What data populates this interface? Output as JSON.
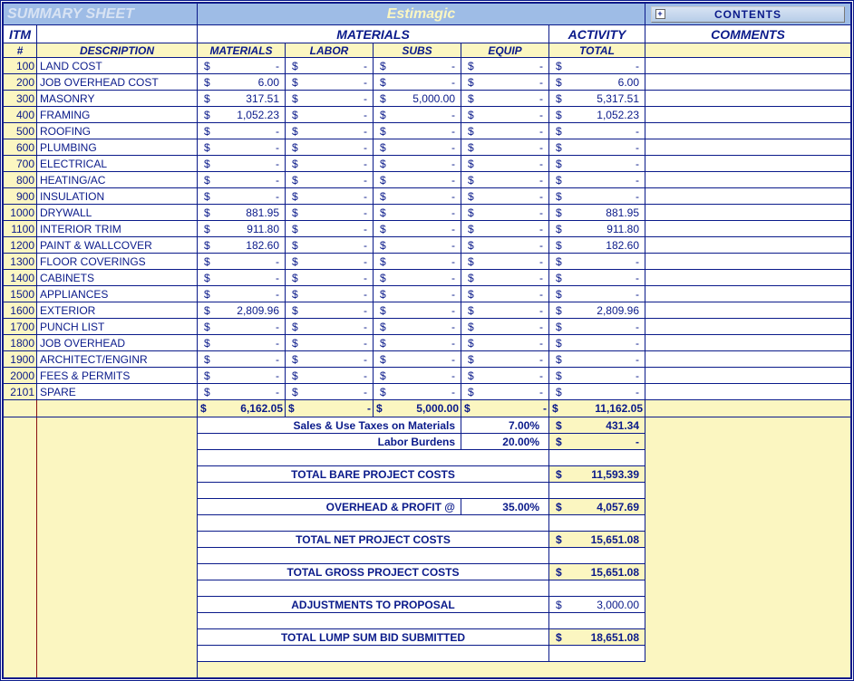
{
  "header": {
    "title_left": "SUMMARY SHEET",
    "title_center": "Estimagic",
    "contents_btn": "CONTENTS"
  },
  "header2": {
    "itm": "ITM",
    "materials": "MATERIALS",
    "activity": "ACTIVITY",
    "comments": "COMMENTS"
  },
  "header3": {
    "num": "#",
    "description": "DESCRIPTION",
    "materials": "MATERIALS",
    "labor": "LABOR",
    "subs": "SUBS",
    "equip": "EQUIP",
    "total": "TOTAL"
  },
  "rows": [
    {
      "itm": "100",
      "desc": "LAND COST",
      "mat": "-",
      "lab": "-",
      "subs": "-",
      "equip": "-",
      "total": "-"
    },
    {
      "itm": "200",
      "desc": "JOB OVERHEAD COST",
      "mat": "6.00",
      "lab": "-",
      "subs": "-",
      "equip": "-",
      "total": "6.00"
    },
    {
      "itm": "300",
      "desc": "MASONRY",
      "mat": "317.51",
      "lab": "-",
      "subs": "5,000.00",
      "equip": "-",
      "total": "5,317.51"
    },
    {
      "itm": "400",
      "desc": "FRAMING",
      "mat": "1,052.23",
      "lab": "-",
      "subs": "-",
      "equip": "-",
      "total": "1,052.23"
    },
    {
      "itm": "500",
      "desc": "ROOFING",
      "mat": "-",
      "lab": "-",
      "subs": "-",
      "equip": "-",
      "total": "-"
    },
    {
      "itm": "600",
      "desc": "PLUMBING",
      "mat": "-",
      "lab": "-",
      "subs": "-",
      "equip": "-",
      "total": "-"
    },
    {
      "itm": "700",
      "desc": "ELECTRICAL",
      "mat": "-",
      "lab": "-",
      "subs": "-",
      "equip": "-",
      "total": "-"
    },
    {
      "itm": "800",
      "desc": "HEATING/AC",
      "mat": "-",
      "lab": "-",
      "subs": "-",
      "equip": "-",
      "total": "-"
    },
    {
      "itm": "900",
      "desc": "INSULATION",
      "mat": "-",
      "lab": "-",
      "subs": "-",
      "equip": "-",
      "total": "-"
    },
    {
      "itm": "1000",
      "desc": "DRYWALL",
      "mat": "881.95",
      "lab": "-",
      "subs": "-",
      "equip": "-",
      "total": "881.95"
    },
    {
      "itm": "1100",
      "desc": "INTERIOR TRIM",
      "mat": "911.80",
      "lab": "-",
      "subs": "-",
      "equip": "-",
      "total": "911.80"
    },
    {
      "itm": "1200",
      "desc": "PAINT & WALLCOVER",
      "mat": "182.60",
      "lab": "-",
      "subs": "-",
      "equip": "-",
      "total": "182.60"
    },
    {
      "itm": "1300",
      "desc": "FLOOR COVERINGS",
      "mat": "-",
      "lab": "-",
      "subs": "-",
      "equip": "-",
      "total": "-"
    },
    {
      "itm": "1400",
      "desc": "CABINETS",
      "mat": "-",
      "lab": "-",
      "subs": "-",
      "equip": "-",
      "total": "-"
    },
    {
      "itm": "1500",
      "desc": "APPLIANCES",
      "mat": "-",
      "lab": "-",
      "subs": "-",
      "equip": "-",
      "total": "-"
    },
    {
      "itm": "1600",
      "desc": "EXTERIOR",
      "mat": "2,809.96",
      "lab": "-",
      "subs": "-",
      "equip": "-",
      "total": "2,809.96"
    },
    {
      "itm": "1700",
      "desc": "PUNCH LIST",
      "mat": "-",
      "lab": "-",
      "subs": "-",
      "equip": "-",
      "total": "-"
    },
    {
      "itm": "1800",
      "desc": "JOB OVERHEAD",
      "mat": "-",
      "lab": "-",
      "subs": "-",
      "equip": "-",
      "total": "-"
    },
    {
      "itm": "1900",
      "desc": "ARCHITECT/ENGINR",
      "mat": "-",
      "lab": "-",
      "subs": "-",
      "equip": "-",
      "total": "-"
    },
    {
      "itm": "2000",
      "desc": "FEES & PERMITS",
      "mat": "-",
      "lab": "-",
      "subs": "-",
      "equip": "-",
      "total": "-"
    },
    {
      "itm": "2101",
      "desc": "SPARE",
      "mat": "-",
      "lab": "-",
      "subs": "-",
      "equip": "-",
      "total": "-"
    }
  ],
  "subtotals": {
    "mat": "6,162.05",
    "lab": "-",
    "subs": "5,000.00",
    "equip": "-",
    "total": "11,162.05"
  },
  "footer": {
    "sales_tax_label": "Sales & Use Taxes on Materials",
    "sales_tax_pct": "7.00%",
    "sales_tax_val": "431.34",
    "labor_burdens_label": "Labor Burdens",
    "labor_burdens_pct": "20.00%",
    "labor_burdens_val": "-",
    "total_bare_label": "TOTAL BARE PROJECT COSTS",
    "total_bare_val": "11,593.39",
    "overhead_label": "OVERHEAD & PROFIT @",
    "overhead_pct": "35.00%",
    "overhead_val": "4,057.69",
    "total_net_label": "TOTAL NET PROJECT COSTS",
    "total_net_val": "15,651.08",
    "total_gross_label": "TOTAL GROSS PROJECT COSTS",
    "total_gross_val": "15,651.08",
    "adjustments_label": "ADJUSTMENTS TO PROPOSAL",
    "adjustments_val": "3,000.00",
    "total_lump_label": "TOTAL LUMP SUM BID SUBMITTED",
    "total_lump_val": "18,651.08"
  },
  "chart_data": {
    "type": "table",
    "title": "Summary Sheet — Estimagic",
    "columns": [
      "ITM",
      "DESCRIPTION",
      "MATERIALS",
      "LABOR",
      "SUBS",
      "EQUIP",
      "TOTAL"
    ],
    "rows": [
      [
        100,
        "LAND COST",
        0,
        0,
        0,
        0,
        0
      ],
      [
        200,
        "JOB OVERHEAD COST",
        6.0,
        0,
        0,
        0,
        6.0
      ],
      [
        300,
        "MASONRY",
        317.51,
        0,
        5000.0,
        0,
        5317.51
      ],
      [
        400,
        "FRAMING",
        1052.23,
        0,
        0,
        0,
        1052.23
      ],
      [
        500,
        "ROOFING",
        0,
        0,
        0,
        0,
        0
      ],
      [
        600,
        "PLUMBING",
        0,
        0,
        0,
        0,
        0
      ],
      [
        700,
        "ELECTRICAL",
        0,
        0,
        0,
        0,
        0
      ],
      [
        800,
        "HEATING/AC",
        0,
        0,
        0,
        0,
        0
      ],
      [
        900,
        "INSULATION",
        0,
        0,
        0,
        0,
        0
      ],
      [
        1000,
        "DRYWALL",
        881.95,
        0,
        0,
        0,
        881.95
      ],
      [
        1100,
        "INTERIOR TRIM",
        911.8,
        0,
        0,
        0,
        911.8
      ],
      [
        1200,
        "PAINT & WALLCOVER",
        182.6,
        0,
        0,
        0,
        182.6
      ],
      [
        1300,
        "FLOOR COVERINGS",
        0,
        0,
        0,
        0,
        0
      ],
      [
        1400,
        "CABINETS",
        0,
        0,
        0,
        0,
        0
      ],
      [
        1500,
        "APPLIANCES",
        0,
        0,
        0,
        0,
        0
      ],
      [
        1600,
        "EXTERIOR",
        2809.96,
        0,
        0,
        0,
        2809.96
      ],
      [
        1700,
        "PUNCH LIST",
        0,
        0,
        0,
        0,
        0
      ],
      [
        1800,
        "JOB OVERHEAD",
        0,
        0,
        0,
        0,
        0
      ],
      [
        1900,
        "ARCHITECT/ENGINR",
        0,
        0,
        0,
        0,
        0
      ],
      [
        2000,
        "FEES & PERMITS",
        0,
        0,
        0,
        0,
        0
      ],
      [
        2101,
        "SPARE",
        0,
        0,
        0,
        0,
        0
      ]
    ],
    "subtotals": {
      "MATERIALS": 6162.05,
      "LABOR": 0,
      "SUBS": 5000.0,
      "EQUIP": 0,
      "TOTAL": 11162.05
    },
    "summary": {
      "sales_use_tax_pct": 7.0,
      "sales_use_tax": 431.34,
      "labor_burdens_pct": 20.0,
      "labor_burdens": 0,
      "total_bare_project_costs": 11593.39,
      "overhead_profit_pct": 35.0,
      "overhead_profit": 4057.69,
      "total_net_project_costs": 15651.08,
      "total_gross_project_costs": 15651.08,
      "adjustments_to_proposal": 3000.0,
      "total_lump_sum_bid_submitted": 18651.08
    }
  }
}
